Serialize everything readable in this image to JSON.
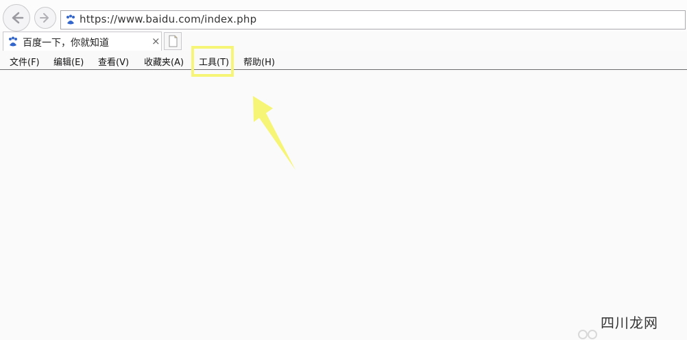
{
  "address_bar": {
    "url": "https://www.baidu.com/index.php"
  },
  "tabs": [
    {
      "title": "百度一下，你就知道",
      "close": "×"
    }
  ],
  "menu": {
    "items": [
      "文件(F)",
      "编辑(E)",
      "查看(V)",
      "收藏夹(A)",
      "工具(T)",
      "帮助(H)"
    ]
  },
  "annotation": {
    "highlight_color": "#f6f575",
    "arrow_color": "#f6f575"
  },
  "watermark": {
    "text": "四川龙网"
  }
}
